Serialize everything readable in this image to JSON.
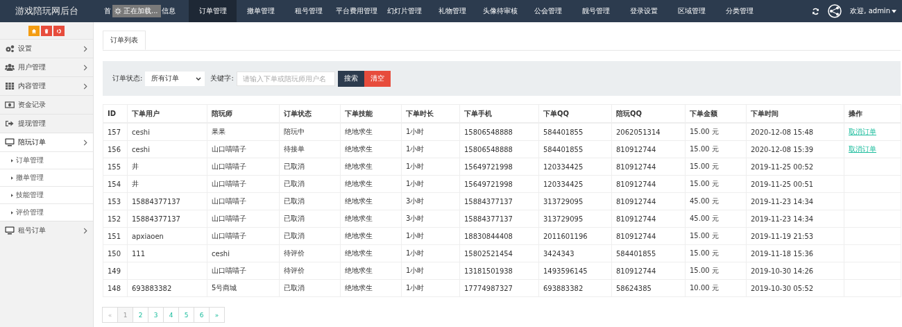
{
  "brand": "游戏陪玩网后台",
  "nav": [
    {
      "label_start": "首",
      "label_end": "信息",
      "selected": false
    },
    {
      "label": "订单管理",
      "selected": true
    },
    {
      "label": "撤单管理",
      "selected": false
    },
    {
      "label": "租号管理",
      "selected": false
    },
    {
      "label": "平台费用管理",
      "selected": false
    },
    {
      "label": "幻灯片管理",
      "selected": false
    },
    {
      "label": "礼物管理",
      "selected": false
    },
    {
      "label": "头像待审核",
      "selected": false
    },
    {
      "label": "公会管理",
      "selected": false
    },
    {
      "label": "靓号管理",
      "selected": false
    },
    {
      "label": "登录设置",
      "selected": false
    },
    {
      "label": "区域管理",
      "selected": false
    },
    {
      "label": "分类管理",
      "selected": false
    }
  ],
  "loading": "正在加载...",
  "user": "欢迎, admin",
  "sidebar": [
    {
      "label": "设置",
      "expanded": false
    },
    {
      "label": "用户管理",
      "expanded": false
    },
    {
      "label": "内容管理",
      "expanded": false
    },
    {
      "label": "资金记录"
    },
    {
      "label": "提现管理"
    },
    {
      "label": "陪玩订单",
      "expanded": true,
      "children": [
        {
          "label": "订单管理"
        },
        {
          "label": "撤单管理"
        },
        {
          "label": "技能管理"
        },
        {
          "label": "评价管理"
        }
      ]
    },
    {
      "label": "租号订单",
      "expanded": false
    }
  ],
  "tab": "订单列表",
  "filter": {
    "status_label": "订单状态:",
    "status_value": "所有订单",
    "keyword_label": "关键字:",
    "keyword_placeholder": "请输入下单或陪玩师用户名",
    "search": "搜索",
    "clear": "清空"
  },
  "table": {
    "columns": [
      "ID",
      "下单用户",
      "陪玩师",
      "订单状态",
      "下单技能",
      "下单时长",
      "下单手机",
      "下单QQ",
      "陪玩QQ",
      "下单金额",
      "下单时间",
      "操作"
    ],
    "rows": [
      {
        "cells": [
          "157",
          "ceshi",
          "果果",
          "陪玩中",
          "绝地求生",
          "1小时",
          "15806548888",
          "584401855",
          "2062051314",
          "15.00 元",
          "2020-12-08 15:48"
        ],
        "action": "取消订单"
      },
      {
        "cells": [
          "156",
          "ceshi",
          "山口喵喵子",
          "待接单",
          "绝地求生",
          "1小时",
          "15806548888",
          "584401855",
          "810912744",
          "15.00 元",
          "2020-12-08 15:39"
        ],
        "action": "取消订单"
      },
      {
        "cells": [
          "155",
          "井",
          "山口喵喵子",
          "已取消",
          "绝地求生",
          "1小时",
          "15649721998",
          "120334425",
          "810912744",
          "15.00 元",
          "2019-11-25 00:52"
        ]
      },
      {
        "cells": [
          "154",
          "井",
          "山口喵喵子",
          "已取消",
          "绝地求生",
          "1小时",
          "15649721998",
          "120334425",
          "810912744",
          "15.00 元",
          "2019-11-25 00:51"
        ]
      },
      {
        "cells": [
          "153",
          "15884377137",
          "山口喵喵子",
          "已取消",
          "绝地求生",
          "3小时",
          "15884377137",
          "313729095",
          "810912744",
          "45.00 元",
          "2019-11-23 14:34"
        ]
      },
      {
        "cells": [
          "152",
          "15884377137",
          "山口喵喵子",
          "已取消",
          "绝地求生",
          "3小时",
          "15884377137",
          "313729095",
          "810912744",
          "45.00 元",
          "2019-11-23 14:34"
        ]
      },
      {
        "cells": [
          "151",
          "apxiaoen",
          "山口喵喵子",
          "已取消",
          "绝地求生",
          "1小时",
          "18830844408",
          "2011601196",
          "810912744",
          "15.00 元",
          "2019-11-19 21:53"
        ]
      },
      {
        "cells": [
          "150",
          "111",
          "ceshi",
          "待评价",
          "绝地求生",
          "1小时",
          "15802521454",
          "3424343",
          "584401855",
          "15.00 元",
          "2019-11-18 15:36"
        ]
      },
      {
        "cells": [
          "149",
          "",
          "山口喵喵子",
          "待评价",
          "绝地求生",
          "1小时",
          "13181501938",
          "1493596145",
          "810912744",
          "15.00 元",
          "2019-10-30 14:26"
        ]
      },
      {
        "cells": [
          "148",
          "693883382",
          "5号商城",
          "已取消",
          "绝地求生",
          "1小时",
          "17774987327",
          "693883382",
          "58624385",
          "10.00 元",
          "2019-10-30 05:52"
        ]
      }
    ]
  },
  "pagination": [
    {
      "label": "«",
      "disabled": true,
      "selected": false
    },
    {
      "label": "1",
      "disabled": false,
      "selected": true
    },
    {
      "label": "2",
      "disabled": false,
      "selected": false
    },
    {
      "label": "3",
      "disabled": false,
      "selected": false
    },
    {
      "label": "4",
      "disabled": false,
      "selected": false
    },
    {
      "label": "5",
      "disabled": false,
      "selected": false
    },
    {
      "label": "6",
      "disabled": false,
      "selected": false
    },
    {
      "label": "»",
      "disabled": false,
      "selected": false
    }
  ]
}
